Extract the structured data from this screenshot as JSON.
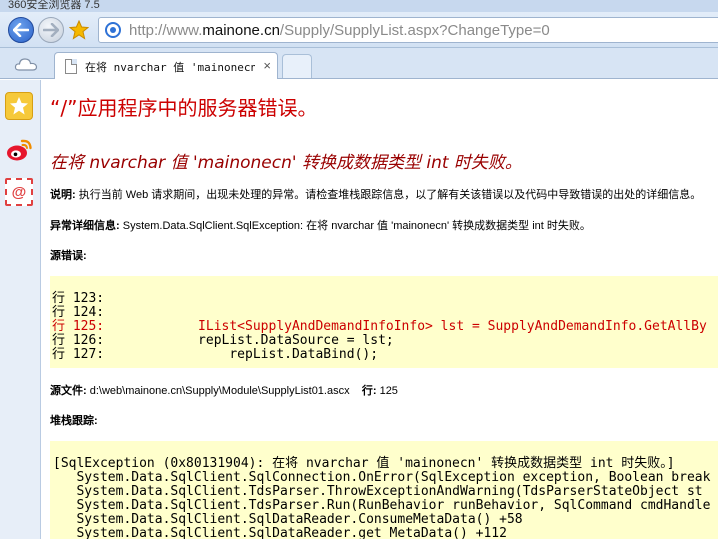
{
  "browser": {
    "window_title": "360安全浏览器 7.5",
    "address": {
      "prefix": "http://www.",
      "host": "mainone.cn",
      "path": "/Supply/SupplyList.aspx?ChangeType=0"
    },
    "tab": {
      "title": "在将 nvarchar 值 'mainonecn'",
      "close_glyph": "×"
    },
    "sidebar_mail_glyph": "@"
  },
  "page": {
    "heading": "“/”应用程序中的服务器错误。",
    "error_title": "在将 nvarchar 值 'mainonecn' 转换成数据类型 int 时失败。",
    "description_label": "说明:",
    "description_text": " 执行当前 Web 请求期间，出现未处理的异常。请检查堆栈跟踪信息，以了解有关该错误以及代码中导致错误的出处的详细信息。",
    "exception_label": "异常详细信息:",
    "exception_text": " System.Data.SqlClient.SqlException: 在将 nvarchar 值 'mainonecn' 转换成数据类型 int 时失败。",
    "source_error_label": "源错误:",
    "source_lines": [
      {
        "text": "行 123:",
        "error": false
      },
      {
        "text": "行 124:",
        "error": false
      },
      {
        "text": "行 125:            IList<SupplyAndDemandInfoInfo> lst = SupplyAndDemandInfo.GetAllBy",
        "error": true
      },
      {
        "text": "行 126:            repList.DataSource = lst;",
        "error": false
      },
      {
        "text": "行 127:                repList.DataBind();",
        "error": false
      }
    ],
    "source_file_label": "源文件:",
    "source_file_value": " d:\\web\\mainone.cn\\Supply\\Module\\SupplyList01.ascx",
    "line_label": "行:",
    "line_value": " 125",
    "stack_label": "堆栈跟踪:",
    "stack_lines": [
      "[SqlException (0x80131904): 在将 nvarchar 值 'mainonecn' 转换成数据类型 int 时失败。]",
      "   System.Data.SqlClient.SqlConnection.OnError(SqlException exception, Boolean break",
      "   System.Data.SqlClient.TdsParser.ThrowExceptionAndWarning(TdsParserStateObject st",
      "   System.Data.SqlClient.TdsParser.Run(RunBehavior runBehavior, SqlCommand cmdHandle",
      "   System.Data.SqlClient.SqlDataReader.ConsumeMetaData() +58",
      "   System.Data.SqlClient.SqlDataReader.get_MetaData() +112"
    ]
  },
  "colors": {
    "heading_red": "#cc0000",
    "title_darkred": "#990000",
    "code_bg": "#ffffcc"
  }
}
